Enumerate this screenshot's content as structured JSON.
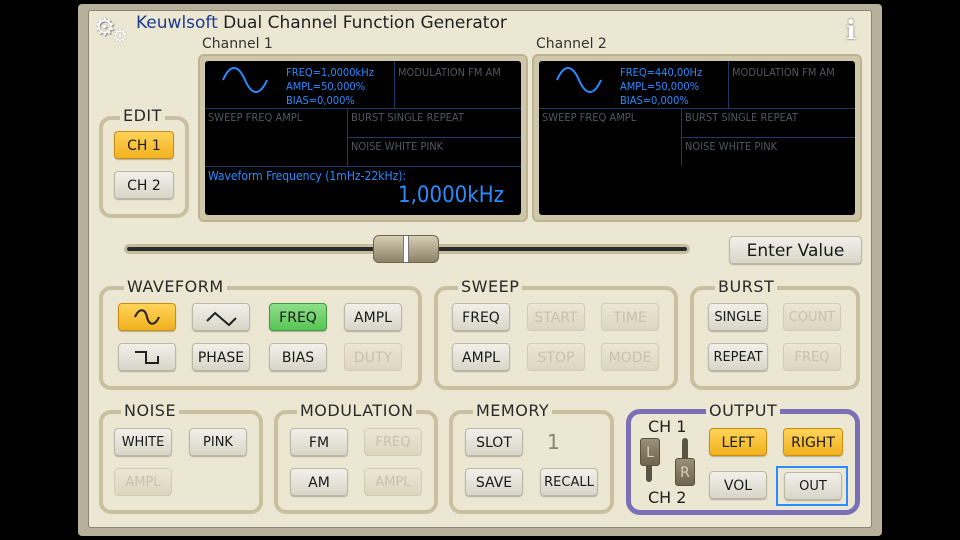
{
  "app": {
    "brand": "Keuwlsoft",
    "title_rest": " Dual Channel Function Generator",
    "info_icon": "i"
  },
  "channel1": {
    "label": "Channel 1",
    "freq": "FREQ=1,0000kHz",
    "ampl": "AMPL=50,000%",
    "bias": "BIAS=0,000%",
    "modulation": "MODULATION FM AM",
    "sweep": "SWEEP  FREQ AMPL",
    "burst": "BURST   SINGLE REPEAT",
    "noise": "NOISE   WHITE   PINK",
    "prompt": "Waveform Frequency (1mHz-22kHz):",
    "value": "1,0000kHz"
  },
  "channel2": {
    "label": "Channel 2",
    "freq": "FREQ=440,00Hz",
    "ampl": "AMPL=50,000%",
    "bias": "BIAS=0,000%",
    "modulation": "MODULATION FM AM",
    "sweep": "SWEEP  FREQ AMPL",
    "burst": "BURST   SINGLE REPEAT",
    "noise": "NOISE   WHITE   PINK"
  },
  "edit": {
    "label": "EDIT",
    "ch1": "CH 1",
    "ch2": "CH 2"
  },
  "enter_value": "Enter Value",
  "waveform": {
    "label": "WAVEFORM",
    "freq": "FREQ",
    "ampl": "AMPL",
    "phase": "PHASE",
    "bias": "BIAS",
    "duty": "DUTY"
  },
  "sweep": {
    "label": "SWEEP",
    "freq": "FREQ",
    "start": "START",
    "time": "TIME",
    "ampl": "AMPL",
    "stop": "STOP",
    "mode": "MODE"
  },
  "burst": {
    "label": "BURST",
    "single": "SINGLE",
    "count": "COUNT",
    "repeat": "REPEAT",
    "freq": "FREQ"
  },
  "noise": {
    "label": "NOISE",
    "white": "WHITE",
    "pink": "PINK",
    "ampl": "AMPL"
  },
  "modulation": {
    "label": "MODULATION",
    "fm": "FM",
    "freq": "FREQ",
    "am": "AM",
    "ampl": "AMPL"
  },
  "memory": {
    "label": "MEMORY",
    "slot": "SLOT",
    "slot_value": "1",
    "save": "SAVE",
    "recall": "RECALL"
  },
  "output": {
    "label": "OUTPUT",
    "ch1": "CH 1",
    "ch2": "CH 2",
    "sw_l": "L",
    "sw_r": "R",
    "left": "LEFT",
    "right": "RIGHT",
    "vol": "VOL",
    "out": "OUT"
  },
  "slider": {
    "position": 0.5
  },
  "colors": {
    "accent_yellow": "#f1b21e",
    "active_green": "#58c455",
    "screen_text": "#2a8cff",
    "output_border": "#7b6fb8"
  },
  "icons": {
    "settings": "gears-icon",
    "info": "info-icon",
    "sine": "sine-wave-icon",
    "triangle": "triangle-wave-icon",
    "square": "square-wave-icon"
  }
}
